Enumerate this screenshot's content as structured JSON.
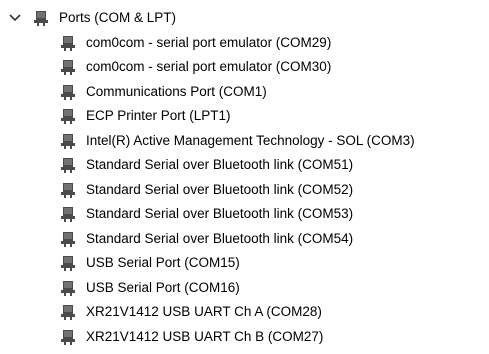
{
  "tree": {
    "category": {
      "label": "Ports (COM & LPT)",
      "expanded": true,
      "icon": "port-connector-icon"
    },
    "devices": [
      {
        "label": "com0com - serial port emulator (COM29)",
        "icon": "port-connector-icon"
      },
      {
        "label": "com0com - serial port emulator (COM30)",
        "icon": "port-connector-icon"
      },
      {
        "label": "Communications Port (COM1)",
        "icon": "port-connector-icon"
      },
      {
        "label": "ECP Printer Port (LPT1)",
        "icon": "port-connector-icon"
      },
      {
        "label": "Intel(R) Active Management Technology - SOL (COM3)",
        "icon": "port-connector-icon"
      },
      {
        "label": "Standard Serial over Bluetooth link (COM51)",
        "icon": "port-connector-icon"
      },
      {
        "label": "Standard Serial over Bluetooth link (COM52)",
        "icon": "port-connector-icon"
      },
      {
        "label": "Standard Serial over Bluetooth link (COM53)",
        "icon": "port-connector-icon"
      },
      {
        "label": "Standard Serial over Bluetooth link (COM54)",
        "icon": "port-connector-icon"
      },
      {
        "label": "USB Serial Port (COM15)",
        "icon": "port-connector-icon"
      },
      {
        "label": "USB Serial Port (COM16)",
        "icon": "port-connector-icon"
      },
      {
        "label": "XR21V1412 USB UART Ch A (COM28)",
        "icon": "port-connector-icon"
      },
      {
        "label": "XR21V1412 USB UART Ch B (COM27)",
        "icon": "port-connector-icon"
      }
    ]
  },
  "colors": {
    "icon_body": "#4a4a4a",
    "icon_pins": "#9a9a9a",
    "chevron": "#333333",
    "text": "#000000"
  }
}
